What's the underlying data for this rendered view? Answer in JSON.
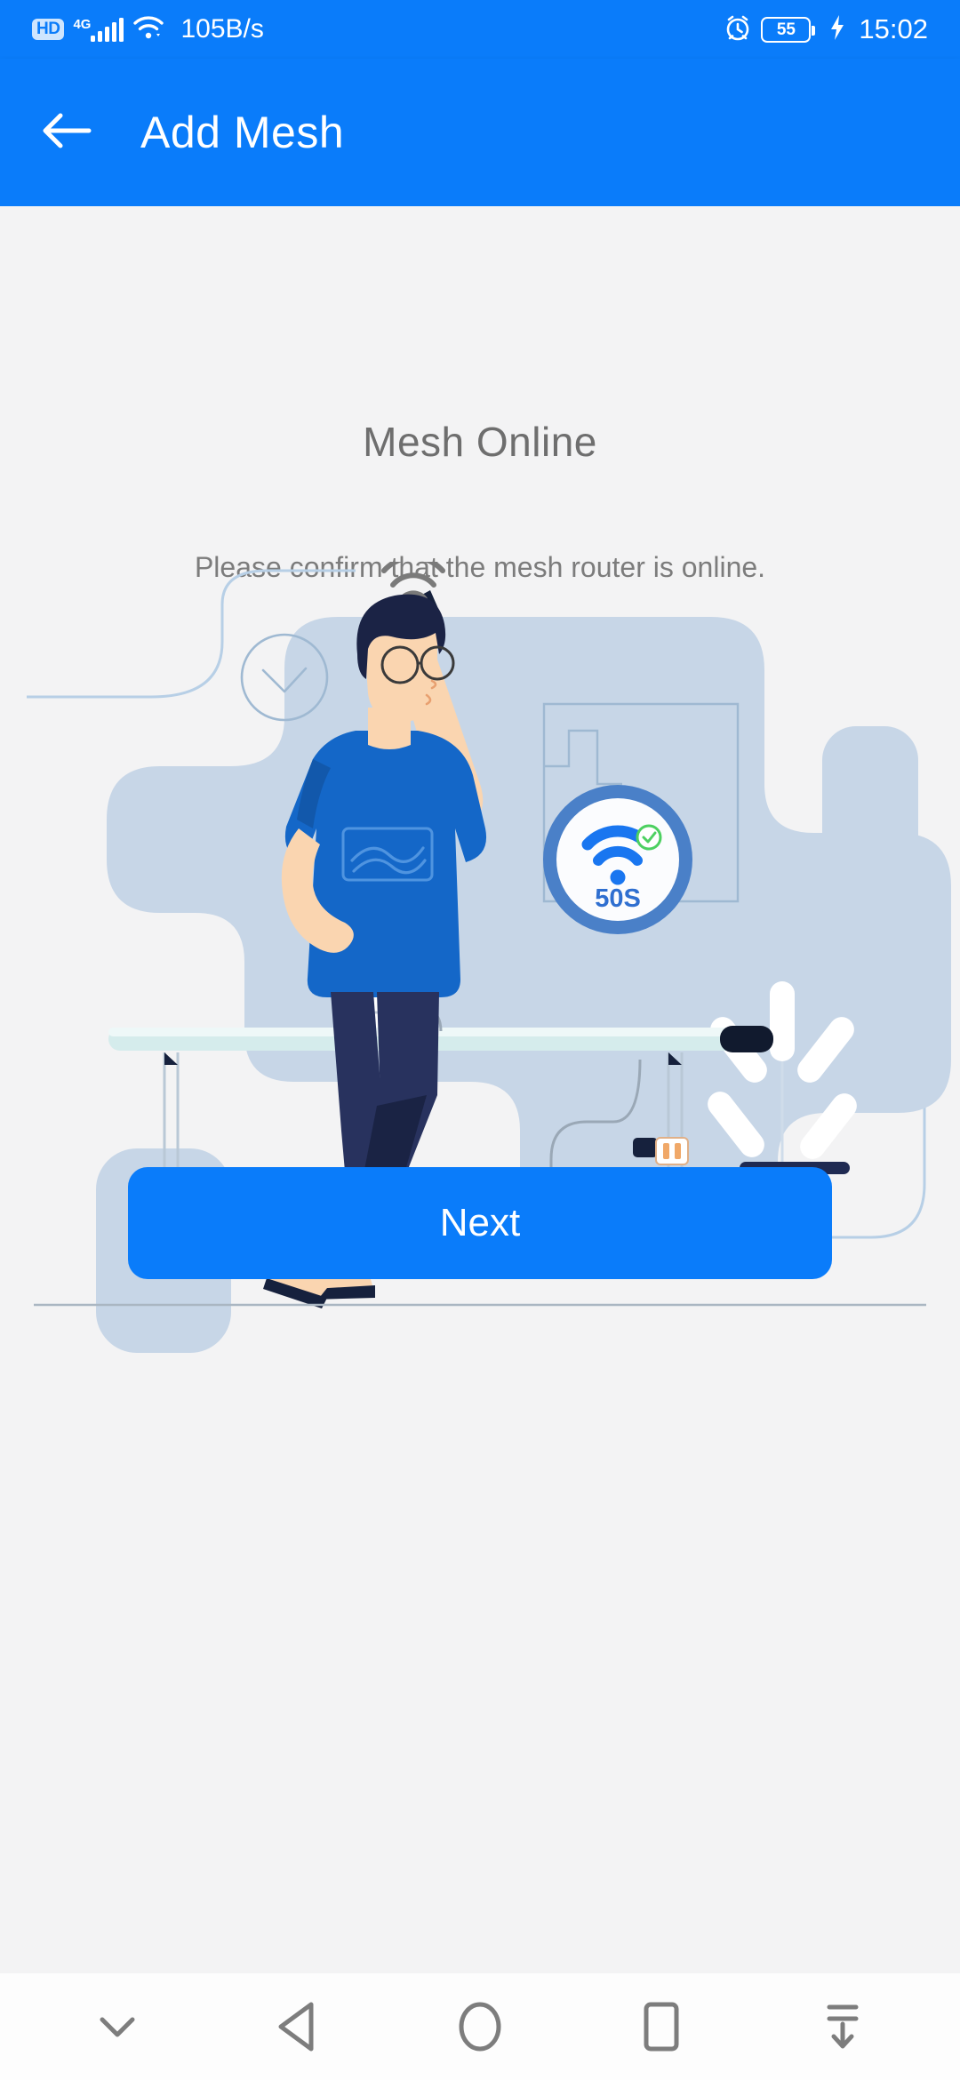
{
  "statusbar": {
    "hd_label": "HD",
    "network_label": "4G",
    "signal_icon": "signal-bars-icon",
    "wifi_icon": "wifi-icon",
    "speed": "105B/s",
    "alarm_icon": "alarm-clock-icon",
    "battery_level": "55",
    "charging_icon": "charging-bolt-icon",
    "time": "15:02"
  },
  "appbar": {
    "back_icon": "back-arrow-icon",
    "title": "Add Mesh",
    "background_color": "#0a7cfa"
  },
  "content": {
    "title": "Mesh Online",
    "subtitle": "Please confirm that the mesh router is online."
  },
  "illustration": {
    "name": "mesh-router-setup-illustration",
    "wifi_badge_label": "50S",
    "wifi_badge_icon": "wifi-icon",
    "check_icon": "check-circle-icon",
    "router_icon": "mesh-router-device",
    "phone_icon": "smartphone-icon",
    "clock_icon": "wall-clock-icon",
    "plant_icon": "plant-icon",
    "colors": {
      "blob": "#c4d4e6",
      "shirt": "#1467c8",
      "pants": "#1f2a52",
      "skin": "#fad5b0",
      "hair": "#1b2345",
      "accent": "#3d77c9",
      "check_green": "#4cd060"
    }
  },
  "footer": {
    "next_label": "Next",
    "next_color": "#0a7cfa"
  },
  "navbar": {
    "items": [
      {
        "name": "collapse-chevron-down-icon",
        "label": "chevron-down"
      },
      {
        "name": "nav-back-icon",
        "label": "back"
      },
      {
        "name": "nav-home-icon",
        "label": "home"
      },
      {
        "name": "nav-recents-icon",
        "label": "recents"
      },
      {
        "name": "nav-download-icon",
        "label": "download"
      }
    ]
  }
}
